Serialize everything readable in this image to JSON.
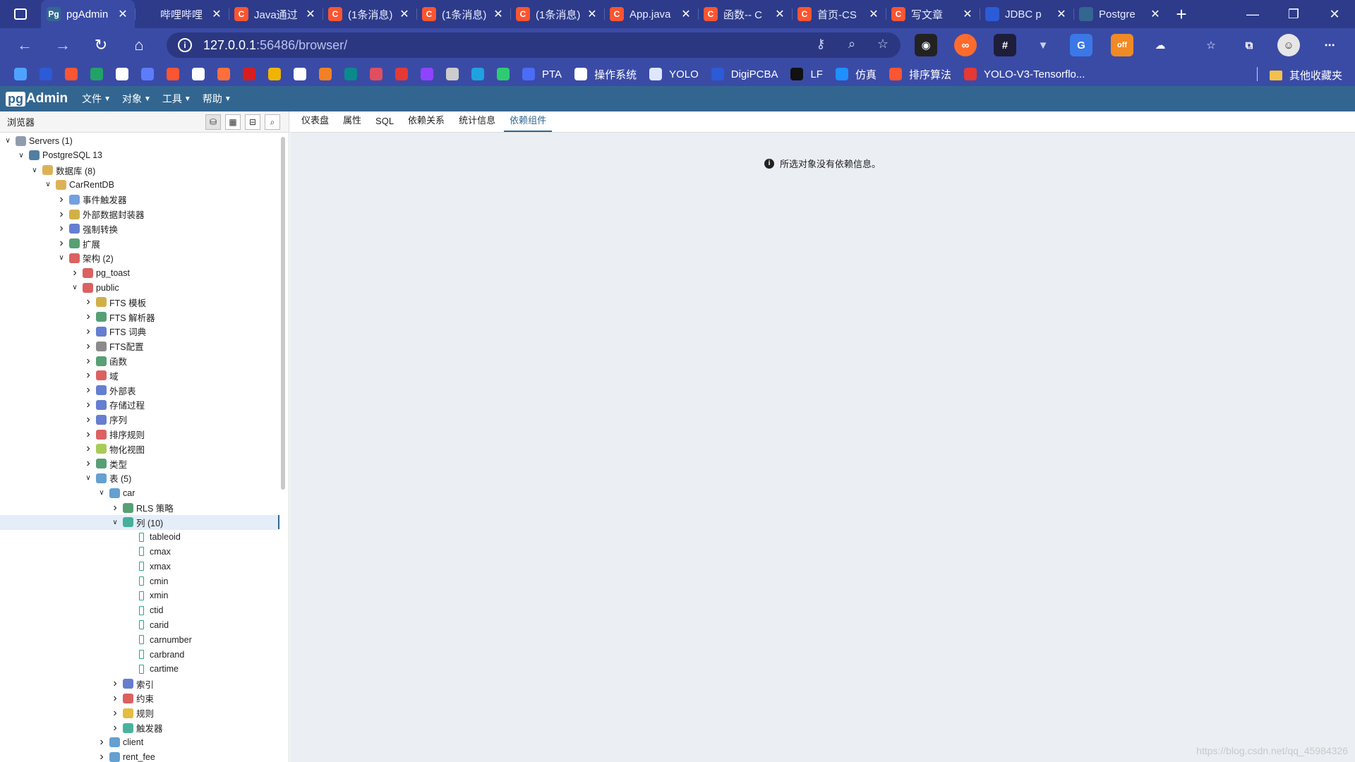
{
  "browser": {
    "tabs": [
      {
        "title": "pgAdmin",
        "favicon": "pg",
        "color": "#336791",
        "active": true
      },
      {
        "title": "哔哩哔哩",
        "favicon": "tv",
        "color": "#2d3b8a"
      },
      {
        "title": "Java通过",
        "favicon": "C",
        "color": "#fc5531"
      },
      {
        "title": "(1条消息)",
        "favicon": "C",
        "color": "#fc5531"
      },
      {
        "title": "(1条消息)",
        "favicon": "C",
        "color": "#fc5531"
      },
      {
        "title": "(1条消息)",
        "favicon": "C",
        "color": "#fc5531"
      },
      {
        "title": "App.java",
        "favicon": "C",
        "color": "#fc5531"
      },
      {
        "title": "函数-- C",
        "favicon": "C",
        "color": "#fc5531"
      },
      {
        "title": "首页-CS",
        "favicon": "C",
        "color": "#fc5531"
      },
      {
        "title": "写文章",
        "favicon": "C",
        "color": "#fc5531"
      },
      {
        "title": "JDBC p",
        "favicon": "paw",
        "color": "#2b5bd7"
      },
      {
        "title": "Postgre",
        "favicon": "elephant",
        "color": "#336791"
      }
    ],
    "new_tab_label": "+",
    "window_controls": {
      "minimize": "—",
      "restore": "❐",
      "close": "✕"
    },
    "url_host": "127.0.0.1",
    "url_path": ":56486/browser/",
    "bookmarks": [
      {
        "icon": "bing-icon",
        "color": "#4da3ff",
        "text": ""
      },
      {
        "icon": "paw-icon",
        "color": "#2b5bd7",
        "text": ""
      },
      {
        "icon": "c-icon",
        "color": "#fc5531",
        "text": ""
      },
      {
        "icon": "flag-icon",
        "color": "#21a366",
        "text": ""
      },
      {
        "icon": "home-icon",
        "color": "#ffffff",
        "text": ""
      },
      {
        "icon": "tv-icon",
        "color": "#5c7cfa",
        "text": ""
      },
      {
        "icon": "c-icon",
        "color": "#fc5531",
        "text": ""
      },
      {
        "icon": "github-icon",
        "color": "#ffffff",
        "text": ""
      },
      {
        "icon": "app-icon",
        "color": "#ff6f3c",
        "text": ""
      },
      {
        "icon": "red-icon",
        "color": "#d71e1e",
        "text": ""
      },
      {
        "icon": "star-icon",
        "color": "#f0b400",
        "text": ""
      },
      {
        "icon": "google-icon",
        "color": "#ffffff",
        "text": ""
      },
      {
        "icon": "stack-icon",
        "color": "#f48024",
        "text": ""
      },
      {
        "icon": "on-icon",
        "color": "#0a8a8a",
        "text": ""
      },
      {
        "icon": "ball-icon",
        "color": "#e04f5f",
        "text": ""
      },
      {
        "icon": "g-icon",
        "color": "#e53935",
        "text": ""
      },
      {
        "icon": "circle-icon",
        "color": "#8e44ff",
        "text": ""
      },
      {
        "icon": "qr-icon",
        "color": "#cccccc",
        "text": ""
      },
      {
        "icon": "edge-icon",
        "color": "#1fa3e0",
        "text": ""
      },
      {
        "icon": "street-icon",
        "color": "#2ecc71",
        "text": ""
      },
      {
        "icon": "pta-icon",
        "color": "#4a6cf7",
        "text": "PTA"
      },
      {
        "icon": "page-icon",
        "color": "#ffffff",
        "text": "操作系统"
      },
      {
        "icon": "yolo-icon",
        "color": "#dfe6ff",
        "text": "YOLO"
      },
      {
        "icon": "digi-icon",
        "color": "#2b5bd7",
        "text": "DigiPCBA"
      },
      {
        "icon": "lf-icon",
        "color": "#111111",
        "text": "LF"
      },
      {
        "icon": "sim-icon",
        "color": "#1e90ff",
        "text": "仿真"
      },
      {
        "icon": "c-icon",
        "color": "#fc5531",
        "text": "排序算法"
      },
      {
        "icon": "g-icon",
        "color": "#e53935",
        "text": "YOLO-V3-Tensorflo..."
      }
    ],
    "other_bookmarks": "其他收藏夹"
  },
  "pgadmin": {
    "logo_pg": "pg",
    "logo_text": "Admin",
    "menus": [
      "文件",
      "对象",
      "工具",
      "帮助"
    ],
    "browser_title": "浏览器",
    "panel_tabs": [
      "仪表盘",
      "属性",
      "SQL",
      "依赖关系",
      "统计信息",
      "依赖组件"
    ],
    "active_tab": "依赖组件",
    "message": "所选对象没有依赖信息。",
    "tree": [
      {
        "label": "Servers (1)",
        "depth": 0,
        "toggle": "open",
        "icon": "servers",
        "color": "#7d8aa0"
      },
      {
        "label": "PostgreSQL 13",
        "depth": 1,
        "toggle": "open",
        "icon": "elephant",
        "color": "#336791"
      },
      {
        "label": "数据库 (8)",
        "depth": 2,
        "toggle": "open",
        "icon": "databases",
        "color": "#d8a33a"
      },
      {
        "label": "CarRentDB",
        "depth": 3,
        "toggle": "open",
        "icon": "database",
        "color": "#d8a33a"
      },
      {
        "label": "事件触发器",
        "depth": 4,
        "toggle": "closed",
        "icon": "event-trigger",
        "color": "#5a8fd8"
      },
      {
        "label": "外部数据封装器",
        "depth": 4,
        "toggle": "closed",
        "icon": "fdw",
        "color": "#c9a227"
      },
      {
        "label": "强制转换",
        "depth": 4,
        "toggle": "closed",
        "icon": "cast",
        "color": "#4a67c8"
      },
      {
        "label": "扩展",
        "depth": 4,
        "toggle": "closed",
        "icon": "extension",
        "color": "#3a8f5a"
      },
      {
        "label": "架构 (2)",
        "depth": 4,
        "toggle": "open",
        "icon": "schemas",
        "color": "#d64545"
      },
      {
        "label": "pg_toast",
        "depth": 5,
        "toggle": "closed",
        "icon": "schema",
        "color": "#d64545"
      },
      {
        "label": "public",
        "depth": 5,
        "toggle": "open",
        "icon": "schema",
        "color": "#d64545"
      },
      {
        "label": "FTS 模板",
        "depth": 6,
        "toggle": "closed",
        "icon": "fts-template",
        "color": "#c9a227"
      },
      {
        "label": "FTS 解析器",
        "depth": 6,
        "toggle": "closed",
        "icon": "fts-parser",
        "color": "#3a8f5a"
      },
      {
        "label": "FTS 词典",
        "depth": 6,
        "toggle": "closed",
        "icon": "fts-dictionary",
        "color": "#4a67c8"
      },
      {
        "label": "FTS配置",
        "depth": 6,
        "toggle": "closed",
        "icon": "fts-config",
        "color": "#777777"
      },
      {
        "label": "函数",
        "depth": 6,
        "toggle": "closed",
        "icon": "function",
        "color": "#3a8f5a"
      },
      {
        "label": "域",
        "depth": 6,
        "toggle": "closed",
        "icon": "domain",
        "color": "#d64545"
      },
      {
        "label": "外部表",
        "depth": 6,
        "toggle": "closed",
        "icon": "foreign-table",
        "color": "#4a67c8"
      },
      {
        "label": "存储过程",
        "depth": 6,
        "toggle": "closed",
        "icon": "procedure",
        "color": "#4a67c8"
      },
      {
        "label": "序列",
        "depth": 6,
        "toggle": "closed",
        "icon": "sequence",
        "color": "#4a67c8"
      },
      {
        "label": "排序规则",
        "depth": 6,
        "toggle": "closed",
        "icon": "collation",
        "color": "#d64545"
      },
      {
        "label": "物化视图",
        "depth": 6,
        "toggle": "closed",
        "icon": "mat-view",
        "color": "#9ac23a"
      },
      {
        "label": "类型",
        "depth": 6,
        "toggle": "closed",
        "icon": "type",
        "color": "#3a8f5a"
      },
      {
        "label": "表 (5)",
        "depth": 6,
        "toggle": "open",
        "icon": "tables",
        "color": "#4a8fc8"
      },
      {
        "label": "car",
        "depth": 7,
        "toggle": "open",
        "icon": "table",
        "color": "#4a8fc8"
      },
      {
        "label": "RLS 策略",
        "depth": 8,
        "toggle": "closed",
        "icon": "rls",
        "color": "#3a8f5a"
      },
      {
        "label": "列 (10)",
        "depth": 8,
        "toggle": "open",
        "icon": "columns",
        "color": "#2aa58a",
        "selected": true
      },
      {
        "label": "tableoid",
        "depth": 9,
        "toggle": "none",
        "icon": "column",
        "color": "#2aa58a"
      },
      {
        "label": "cmax",
        "depth": 9,
        "toggle": "none",
        "icon": "column",
        "color": "#2aa58a"
      },
      {
        "label": "xmax",
        "depth": 9,
        "toggle": "none",
        "icon": "column",
        "color": "#2aa58a"
      },
      {
        "label": "cmin",
        "depth": 9,
        "toggle": "none",
        "icon": "column",
        "color": "#2aa58a"
      },
      {
        "label": "xmin",
        "depth": 9,
        "toggle": "none",
        "icon": "column",
        "color": "#2aa58a"
      },
      {
        "label": "ctid",
        "depth": 9,
        "toggle": "none",
        "icon": "column",
        "color": "#2aa58a"
      },
      {
        "label": "carid",
        "depth": 9,
        "toggle": "none",
        "icon": "column",
        "color": "#2aa58a"
      },
      {
        "label": "carnumber",
        "depth": 9,
        "toggle": "none",
        "icon": "column",
        "color": "#2aa58a"
      },
      {
        "label": "carbrand",
        "depth": 9,
        "toggle": "none",
        "icon": "column",
        "color": "#2aa58a"
      },
      {
        "label": "cartime",
        "depth": 9,
        "toggle": "none",
        "icon": "column",
        "color": "#2aa58a"
      },
      {
        "label": "索引",
        "depth": 8,
        "toggle": "closed",
        "icon": "index",
        "color": "#4a67c8"
      },
      {
        "label": "约束",
        "depth": 8,
        "toggle": "closed",
        "icon": "constraints",
        "color": "#d64545"
      },
      {
        "label": "规则",
        "depth": 8,
        "toggle": "closed",
        "icon": "rules",
        "color": "#e0b020"
      },
      {
        "label": "触发器",
        "depth": 8,
        "toggle": "closed",
        "icon": "triggers",
        "color": "#2aa58a"
      },
      {
        "label": "client",
        "depth": 7,
        "toggle": "closed",
        "icon": "table",
        "color": "#4a8fc8"
      },
      {
        "label": "rent_fee",
        "depth": 7,
        "toggle": "closed",
        "icon": "table",
        "color": "#4a8fc8"
      }
    ]
  },
  "watermark": "https://blog.csdn.net/qq_45984326"
}
